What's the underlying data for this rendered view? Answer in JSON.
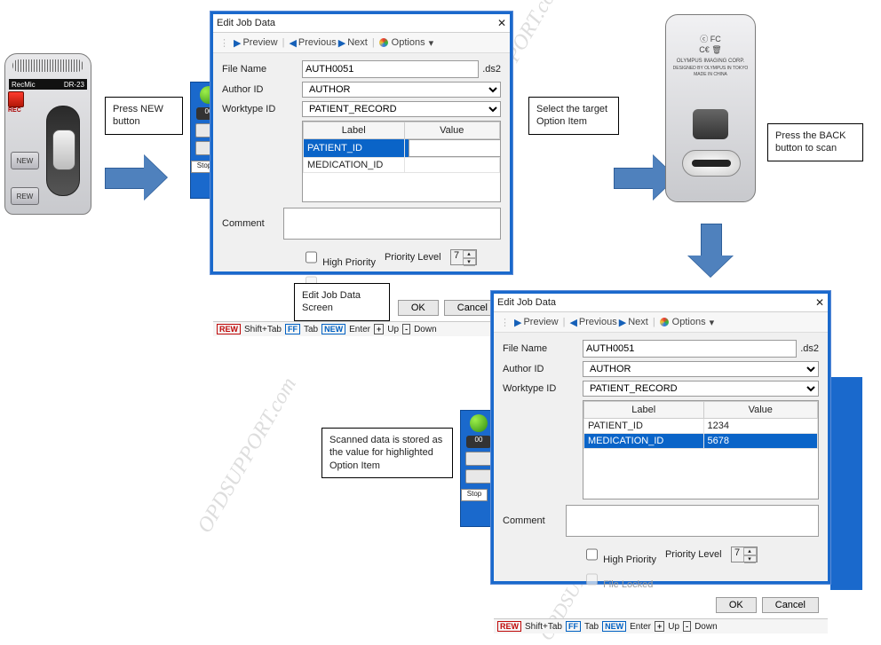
{
  "device_front": {
    "brand": "RecMic",
    "model": "DR-23",
    "rec_label": "REC",
    "new_label": "NEW",
    "rew_label": "REW"
  },
  "device_back": {
    "marks": "ⓒ FC",
    "ce": "C€ 🗑",
    "maker": "OLYMPUS IMAGING CORP.",
    "origin": "DESIGNED BY OLYMPUS IN TOKYO",
    "made": "MADE IN CHINA"
  },
  "callouts": {
    "press_new": "Press NEW button",
    "screen_label": "Edit Job Data Screen",
    "select_option": "Select the target Option Item",
    "press_back": "Press the BACK button to scan",
    "scanned": "Scanned data is stored as the value for highlighted Option Item"
  },
  "dialog": {
    "title": "Edit Job Data",
    "nav": {
      "preview": "Preview",
      "previous": "Previous",
      "next": "Next",
      "options": "Options"
    },
    "labels": {
      "filename": "File Name",
      "author": "Author ID",
      "worktype": "Worktype ID",
      "grid_label": "Label",
      "grid_value": "Value",
      "comment": "Comment",
      "high_priority": "High Priority",
      "priority_level": "Priority Level",
      "file_locked": "File Locked",
      "ok": "OK",
      "cancel": "Cancel"
    },
    "keys": {
      "rew": "REW",
      "shift_tab": "Shift+Tab",
      "ff": "FF",
      "tab": "Tab",
      "new": "NEW",
      "enter": "Enter",
      "plus": "+",
      "up": "Up",
      "minus": "-",
      "down": "Down"
    },
    "values": {
      "filename": "AUTH0051",
      "file_ext": ".ds2",
      "author": "AUTHOR",
      "worktype": "PATIENT_RECORD",
      "priority": "7"
    }
  },
  "dialog1_grid": [
    {
      "label": "PATIENT_ID",
      "value": "",
      "selected": true,
      "editable": true
    },
    {
      "label": "MEDICATION_ID",
      "value": "",
      "selected": false
    }
  ],
  "dialog2_grid": [
    {
      "label": "PATIENT_ID",
      "value": "1234",
      "selected": false
    },
    {
      "label": "MEDICATION_ID",
      "value": "5678",
      "selected": true
    }
  ],
  "bgicon": {
    "stop": "Stop"
  },
  "watermark": "OPDSUPPORT.com"
}
